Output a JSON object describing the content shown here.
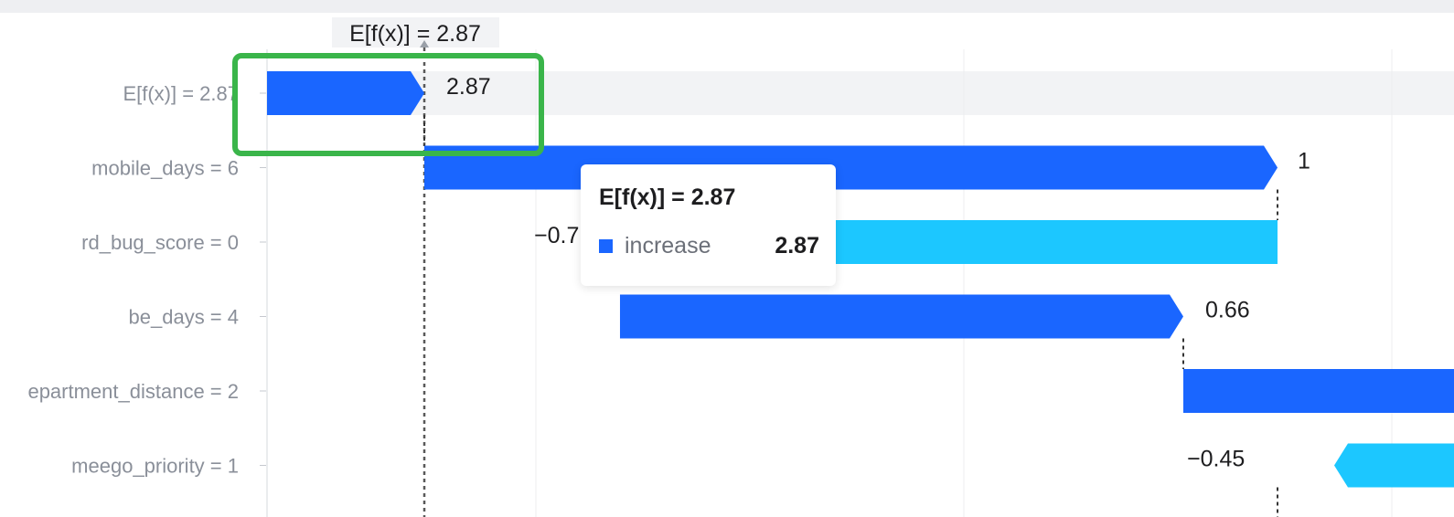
{
  "chart_data": {
    "type": "waterfall",
    "base": {
      "label": "E[f(x)] = 2.87",
      "value": 2.87
    },
    "categories": [
      "E[f(x)] = 2.87",
      "mobile_days = 6",
      "rd_bug_score = 0",
      "be_days = 4",
      "epartment_distance = 2",
      "meego_priority = 1"
    ],
    "contributions": [
      2.87,
      1,
      -0.7,
      0.66,
      null,
      -0.45
    ],
    "value_labels": [
      "2.87",
      "1",
      "−0.7",
      "0.66",
      "",
      "−0.45"
    ],
    "colors": {
      "increase": "#1a66ff",
      "decrease": "#1cc7ff"
    },
    "grid": true
  },
  "tooltip": {
    "title": "E[f(x)] = 2.87",
    "series_name": "increase",
    "value": "2.87",
    "swatch_color": "#1a66ff"
  }
}
